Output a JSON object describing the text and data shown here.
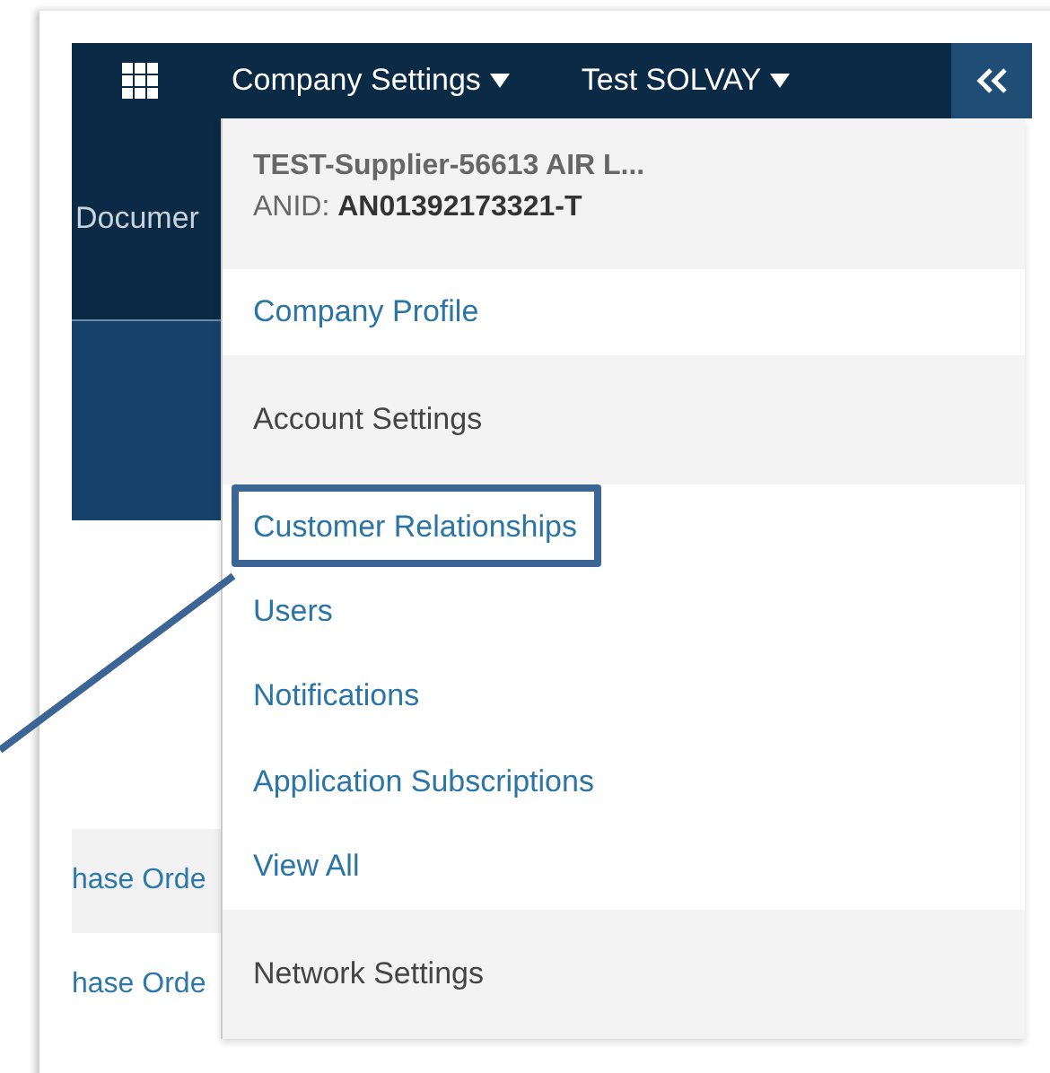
{
  "top_bar": {
    "menus": [
      {
        "label": "Company Settings"
      },
      {
        "label": "Test SOLVAY"
      }
    ]
  },
  "side_tab": {
    "label": "Documer"
  },
  "rows": [
    {
      "label": "hase Orde"
    },
    {
      "label": "hase Orde"
    }
  ],
  "dropdown": {
    "account_name": "TEST-Supplier-56613 AIR L...",
    "anid_label": "ANID:",
    "anid_value": "AN01392173321-T",
    "items": [
      {
        "kind": "link",
        "label": "Company Profile",
        "highlighted": false
      },
      {
        "kind": "section",
        "label": "Account Settings",
        "highlighted": false
      },
      {
        "kind": "link",
        "label": "Customer Relationships",
        "highlighted": true
      },
      {
        "kind": "link",
        "label": "Users",
        "highlighted": false
      },
      {
        "kind": "link",
        "label": "Notifications",
        "highlighted": false
      },
      {
        "kind": "link",
        "label": "Application Subscriptions",
        "highlighted": false
      },
      {
        "kind": "link",
        "label": "View All",
        "highlighted": false
      },
      {
        "kind": "section",
        "label": "Network Settings",
        "highlighted": false
      }
    ]
  }
}
